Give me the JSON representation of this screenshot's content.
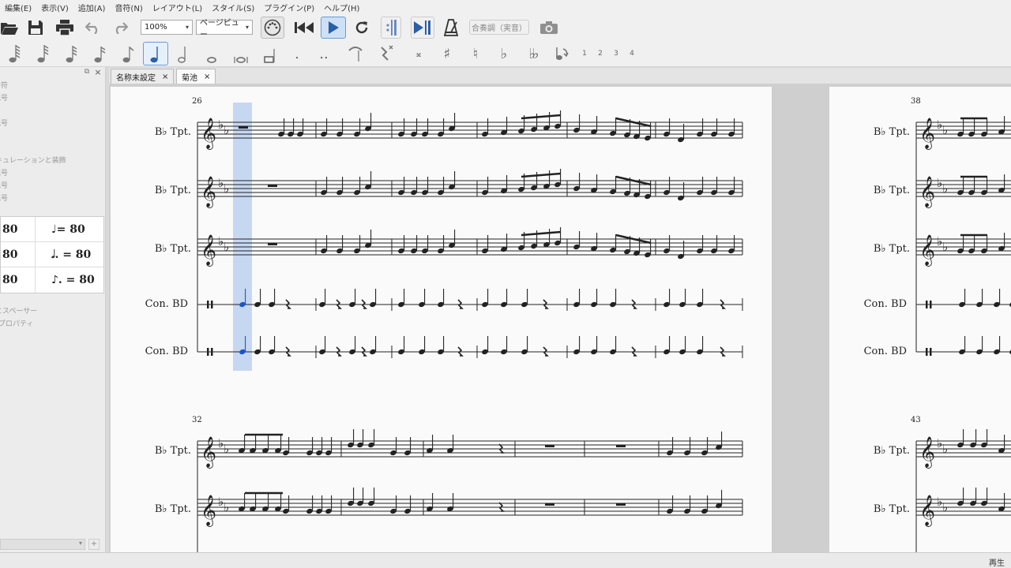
{
  "menu": [
    "編集(E)",
    "表示(V)",
    "追加(A)",
    "音符(N)",
    "レイアウト(L)",
    "スタイル(S)",
    "プラグイン(P)",
    "ヘルプ(H)"
  ],
  "toolbar": {
    "zoom": "100%",
    "view_mode": "ページビュー",
    "concert_pitch": "合奏調（実音）"
  },
  "note_input": {
    "voices": [
      "1",
      "2",
      "3",
      "4"
    ]
  },
  "left_panel": {
    "items": [
      "音符",
      "記号",
      "記号",
      "キュレーションと装飾",
      "記号",
      "記号",
      "記号",
      "とスペーサー",
      "プロパティ"
    ],
    "tempo_rows": [
      {
        "left": "80",
        "right": "♩= 80"
      },
      {
        "left": "80",
        "right": "𝅗𝅥. = 80"
      },
      {
        "left": "80",
        "right": "♪. = 80"
      }
    ]
  },
  "tabs": [
    {
      "label": "名称未設定",
      "close": "×"
    },
    {
      "label": "菊池",
      "close": "×"
    }
  ],
  "score": {
    "page1": {
      "system1_measure": "26",
      "system2_measure": "32",
      "system1_staves": [
        "B♭ Tpt.",
        "B♭ Tpt.",
        "B♭ Tpt.",
        "Con. BD",
        "Con. BD"
      ],
      "system2_staves": [
        "B♭ Tpt.",
        "B♭ Tpt."
      ]
    },
    "page2": {
      "system1_measure": "38",
      "system2_measure": "43",
      "system1_staves": [
        "B♭ Tpt.",
        "B♭ Tpt.",
        "B♭ Tpt.",
        "Con. BD",
        "Con. BD"
      ],
      "system2_staves": [
        "B♭ Tpt.",
        "B♭ Tpt."
      ]
    }
  },
  "status": {
    "mode": "再生"
  },
  "colors": {
    "selection": "#bcd0ee",
    "selected_note": "#1a56c8",
    "play_button_bg": "#cde0f5"
  }
}
